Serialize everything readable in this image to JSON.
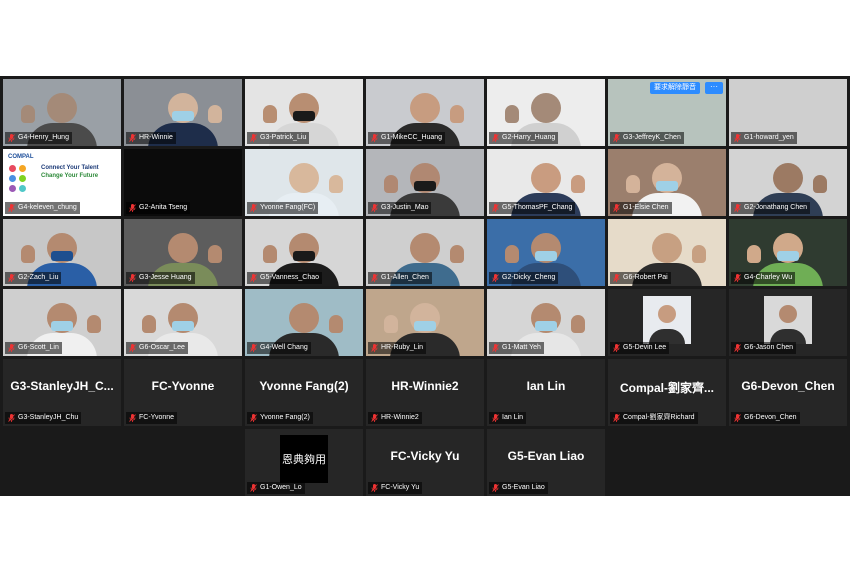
{
  "tiles": [
    {
      "name": "G4-Henry_Hung",
      "type": "video",
      "bg": "#9aa0a6",
      "skin": "#a48a78",
      "shirt": "#4b4b4b"
    },
    {
      "name": "HR-Winnie",
      "type": "video",
      "bg": "#8b8f95",
      "skin": "#d2b49c",
      "shirt": "#1e2d4a",
      "mask": true
    },
    {
      "name": "G3-Patrick_Liu",
      "type": "video",
      "bg": "#e4e4e4",
      "skin": "#b88e72",
      "shirt": "#d6d6d6",
      "mask": true,
      "mask_color": "#1a1a1a"
    },
    {
      "name": "G1-MikeCC_Huang",
      "type": "video",
      "bg": "#c9cbcf",
      "skin": "#c79c80",
      "shirt": "#2a2a2a"
    },
    {
      "name": "G2-Harry_Huang",
      "type": "video",
      "bg": "#ededed",
      "skin": "#a48a78",
      "shirt": "#d0d0d0"
    },
    {
      "name": "G3-JeffreyK_Chen",
      "type": "video",
      "bg": "#b7c3bd",
      "skin": "#b7c3bd",
      "shirt": "#b7c3bd",
      "unmute_label": "要求解除靜音",
      "more_label": "···"
    },
    {
      "name": "G1-howard_yen",
      "type": "video",
      "bg": "#cfcfcf",
      "skin": "#cfcfcf",
      "shirt": "#cfcfcf"
    },
    {
      "name": "G4-keleven_chung",
      "type": "slide",
      "bg": "#ffffff",
      "slide_brand": "COMPAL",
      "slide_line1": "Connect Your Talent",
      "slide_line2": "Change Your Future"
    },
    {
      "name": "G2-Anita Tseng",
      "type": "video",
      "bg": "#0b0b0b",
      "skin": "#0b0b0b",
      "shirt": "#0b0b0b"
    },
    {
      "name": "Yvonne Fang(FC)",
      "type": "video",
      "bg": "#dfe6ea",
      "skin": "#d8b89c",
      "shirt": "#e7eef3",
      "active": true
    },
    {
      "name": "G3-Justin_Mao",
      "type": "video",
      "bg": "#b4b6ba",
      "skin": "#b08872",
      "shirt": "#3a3a3a",
      "mask": true,
      "mask_color": "#1a1a1a"
    },
    {
      "name": "G5-ThomasPF_Chang",
      "type": "video",
      "bg": "#e9e9e9",
      "skin": "#c99c80",
      "shirt": "#2c3c5a"
    },
    {
      "name": "G1-Elsie Chen",
      "type": "video",
      "bg": "#9b7f6d",
      "skin": "#d4b39a",
      "shirt": "#f2f2f2",
      "mask": true
    },
    {
      "name": "G2-Jonathang Chen",
      "type": "video",
      "bg": "#d3d3d3",
      "skin": "#9c7a63",
      "shirt": "#2f3e55"
    },
    {
      "name": "G2-Zach_Liu",
      "type": "video",
      "bg": "#c7c7c7",
      "skin": "#b48a70",
      "shirt": "#2a5fa6",
      "mask": true,
      "mask_color": "#1e4f8f"
    },
    {
      "name": "G3-Jesse Huang",
      "type": "video",
      "bg": "#5d5d5d",
      "skin": "#b48a70",
      "shirt": "#7a8c5a"
    },
    {
      "name": "G5-Vanness_Chao",
      "type": "video",
      "bg": "#d6d6d6",
      "skin": "#b48a70",
      "shirt": "#1c1c1c",
      "mask": true,
      "mask_color": "#1a1a1a"
    },
    {
      "name": "G1-Allen_Chen",
      "type": "video",
      "bg": "#cfcfcf",
      "skin": "#b48a70",
      "shirt": "#3f6c8e"
    },
    {
      "name": "G2-Dicky_Cheng",
      "type": "video",
      "bg": "#3b6ea8",
      "skin": "#b48a70",
      "shirt": "#2e4f7a",
      "mask": true
    },
    {
      "name": "G6-Robert Pai",
      "type": "video",
      "bg": "#e6dbc9",
      "skin": "#c7a082",
      "shirt": "#2c2c2c"
    },
    {
      "name": "G4-Charley Wu",
      "type": "video",
      "bg": "#2f3b30",
      "skin": "#d0a98a",
      "shirt": "#6fae55",
      "mask": true
    },
    {
      "name": "G6-Scott_Lin",
      "type": "video",
      "bg": "#cfcfcf",
      "skin": "#b48a70",
      "shirt": "#f0f0f0",
      "mask": true
    },
    {
      "name": "G6-Oscar_Lee",
      "type": "video",
      "bg": "#d9d9d9",
      "skin": "#b48a70",
      "shirt": "#e9e9e9",
      "mask": true
    },
    {
      "name": "G4-Well Chang",
      "type": "video",
      "bg": "#9fbcc6",
      "skin": "#b48a70",
      "shirt": "#2a2a2a"
    },
    {
      "name": "HR-Ruby_Lin",
      "type": "video",
      "bg": "#bfa68c",
      "skin": "#d2b49c",
      "shirt": "#2a2a2a",
      "mask": true
    },
    {
      "name": "G1-Matt Yeh",
      "type": "video",
      "bg": "#d6d6d6",
      "skin": "#b48a70",
      "shirt": "#e6e6e6",
      "mask": true
    },
    {
      "name": "G5-Devin Lee",
      "type": "avatar",
      "bg": "#262626",
      "avatar_bg": "#e8ebef",
      "avatar_skin": "#c79c80"
    },
    {
      "name": "G6-Jason Chen",
      "type": "avatar",
      "bg": "#262626",
      "avatar_bg": "#d9d9d9",
      "avatar_skin": "#b48a70"
    },
    {
      "name": "G3-StanleyJH_Chu",
      "type": "name",
      "big": "G3-StanleyJH_C..."
    },
    {
      "name": "FC-Yvonne",
      "type": "name",
      "big": "FC-Yvonne"
    },
    {
      "name": "Yvonne Fang(2)",
      "type": "name",
      "big": "Yvonne Fang(2)"
    },
    {
      "name": "HR-Winnie2",
      "type": "name",
      "big": "HR-Winnie2"
    },
    {
      "name": "Ian Lin",
      "type": "name",
      "big": "Ian Lin"
    },
    {
      "name": "Compal-劉家齊Richard",
      "type": "name",
      "big": "Compal-劉家齊..."
    },
    {
      "name": "G6-Devon_Chen",
      "type": "name",
      "big": "G6-Devon_Chen"
    },
    {
      "name": "G1-Owen_Lo",
      "type": "calligraphy",
      "calligraphy": "恩典夠用"
    },
    {
      "name": "FC-Vicky Yu",
      "type": "name",
      "big": "FC-Vicky Yu"
    },
    {
      "name": "G5-Evan Liao",
      "type": "name",
      "big": "G5-Evan Liao"
    }
  ]
}
